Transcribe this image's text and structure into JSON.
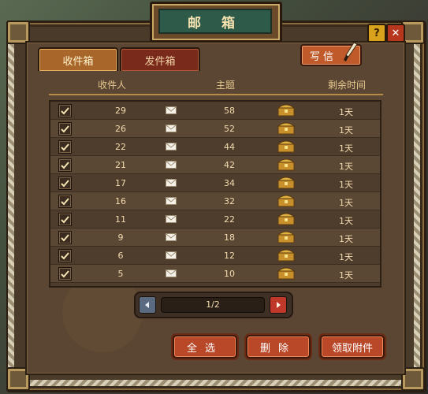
{
  "window": {
    "title": "邮 箱"
  },
  "controls": {
    "help": "?",
    "close": "✕"
  },
  "tabs": [
    {
      "label": "收件箱",
      "active": true
    },
    {
      "label": "发件箱",
      "active": false
    }
  ],
  "write_button": {
    "label": "写信"
  },
  "columns": {
    "sender": "收件人",
    "subject": "主题",
    "remaining": "剩余时间"
  },
  "rows": [
    {
      "checked": true,
      "sender": "29",
      "subject": "58",
      "remaining": "1天"
    },
    {
      "checked": true,
      "sender": "26",
      "subject": "52",
      "remaining": "1天"
    },
    {
      "checked": true,
      "sender": "22",
      "subject": "44",
      "remaining": "1天"
    },
    {
      "checked": true,
      "sender": "21",
      "subject": "42",
      "remaining": "1天"
    },
    {
      "checked": true,
      "sender": "17",
      "subject": "34",
      "remaining": "1天"
    },
    {
      "checked": true,
      "sender": "16",
      "subject": "32",
      "remaining": "1天"
    },
    {
      "checked": true,
      "sender": "11",
      "subject": "22",
      "remaining": "1天"
    },
    {
      "checked": true,
      "sender": "9",
      "subject": "18",
      "remaining": "1天"
    },
    {
      "checked": true,
      "sender": "6",
      "subject": "12",
      "remaining": "1天"
    },
    {
      "checked": true,
      "sender": "5",
      "subject": "10",
      "remaining": "1天"
    }
  ],
  "pager": {
    "label": "1/2"
  },
  "actions": {
    "select_all": "全选",
    "delete": "删除",
    "claim": "领取附件"
  },
  "colors": {
    "accent": "#b84828",
    "panel": "#5a4632",
    "title_plate": "#2e5a4a"
  }
}
